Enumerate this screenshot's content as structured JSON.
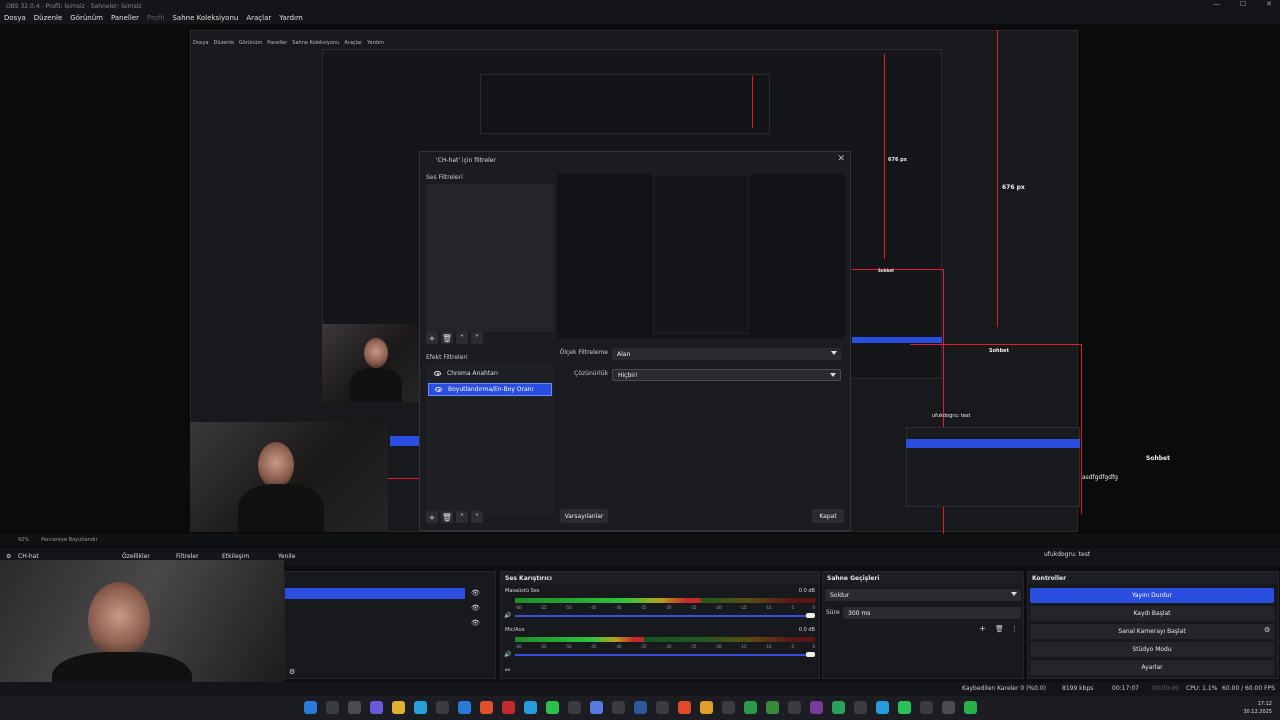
{
  "window": {
    "title": "OBS 32.0.4 - Profil: İsimsiz - Sahneler: İsimsiz"
  },
  "menu": [
    "Dosya",
    "Düzenle",
    "Görünüm",
    "Paneller",
    "Profil",
    "Sahne Koleksiyonu",
    "Araçlar",
    "Yardım"
  ],
  "dialog": {
    "title": "'CH-hat' için filtreler",
    "audio_filters_label": "Ses Filtreleri",
    "effect_filters_label": "Efekt Filtreleri",
    "filters": [
      "Chroma Anahtarı",
      "Boyutlandırma/En-Boy Oranı"
    ],
    "prop_filter_label": "Ölçek Filtreleme",
    "prop_filter_value": "Alan",
    "prop_resolution_label": "Çözünürlük",
    "prop_resolution_value": "Hiçbiri",
    "defaults_button": "Varsayılanlar",
    "close_button": "Kapat"
  },
  "overlay": {
    "px_676": "676 px",
    "px_676b": "676 px",
    "chat_label": "Sohbet",
    "chat_label2": "Sohbet",
    "chat_label3": "Sohbet",
    "nested_chat_user": "ufukdogru: test",
    "handle": "asdfgdfgdfg"
  },
  "zoombar": {
    "zoom": "92%",
    "fit": "Pencereye Boyutlandır"
  },
  "sourcebar": {
    "source": "CH-hat",
    "properties": "Özellikler",
    "filters": "Filtreler",
    "interact": "Etkileşim",
    "refresh": "Yenile",
    "chat_line": "ufukdogru: test"
  },
  "mixer": {
    "title": "Ses Karıştırıcı",
    "channels": [
      {
        "name": "Masaüstü Ses",
        "db": "0.0 dB",
        "level": 0.62
      },
      {
        "name": "Mic/Aux",
        "db": "0.0 dB",
        "level": 0.43
      }
    ],
    "ticks": [
      "-60",
      "-55",
      "-50",
      "-45",
      "-40",
      "-35",
      "-30",
      "-25",
      "-20",
      "-15",
      "-10",
      "-5",
      "0"
    ]
  },
  "transitions": {
    "title": "Sahne Geçişleri",
    "type": "Soldur",
    "duration_label": "Süre",
    "duration_value": "300 ms"
  },
  "controls": {
    "title": "Kontroller",
    "buttons": [
      "Yayını Durdur",
      "Kaydı Başlat",
      "Sanal Kamerayı Başlat",
      "Stüdyo Modu",
      "Ayarlar"
    ]
  },
  "status": {
    "dropped": "Kaybedilen Kareler 0 (%0.0)",
    "bitrate": "8199 kbps",
    "live_time": "00:17:07",
    "rec_time": "00:00:00",
    "cpu": "CPU: 1.1%",
    "fps": "60.00 / 60.00 FPS"
  },
  "clock": {
    "time": "17:12",
    "date": "30.12.2025"
  },
  "colors": {
    "accent": "#2a4ee0",
    "guide": "#e11d2a"
  }
}
